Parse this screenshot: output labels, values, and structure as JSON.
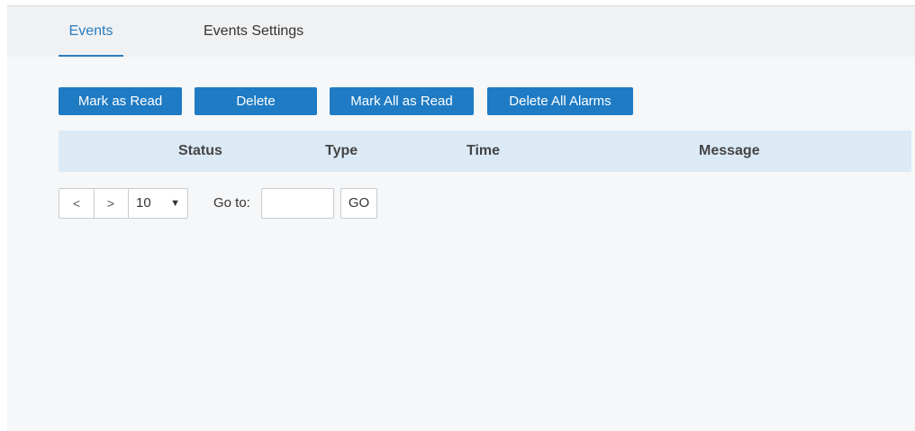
{
  "tabs": {
    "events_label": "Events",
    "settings_label": "Events Settings",
    "active": "Events"
  },
  "toolbar": {
    "mark_read_label": "Mark as Read",
    "delete_label": "Delete",
    "mark_all_read_label": "Mark All as Read",
    "delete_all_label": "Delete All Alarms"
  },
  "table": {
    "columns": [
      "Status",
      "Type",
      "Time",
      "Message"
    ],
    "rows": []
  },
  "pagination": {
    "prev_symbol": "<",
    "next_symbol": ">",
    "page_size": "10",
    "page_size_caret": "▼",
    "goto_label": "Go to:",
    "goto_value": "",
    "go_label": "GO"
  },
  "colors": {
    "accent": "#1e7bc4",
    "tab_active": "#2a7dc0",
    "table_header_bg": "#dceaf6",
    "page_bg": "#f5f7f8"
  }
}
